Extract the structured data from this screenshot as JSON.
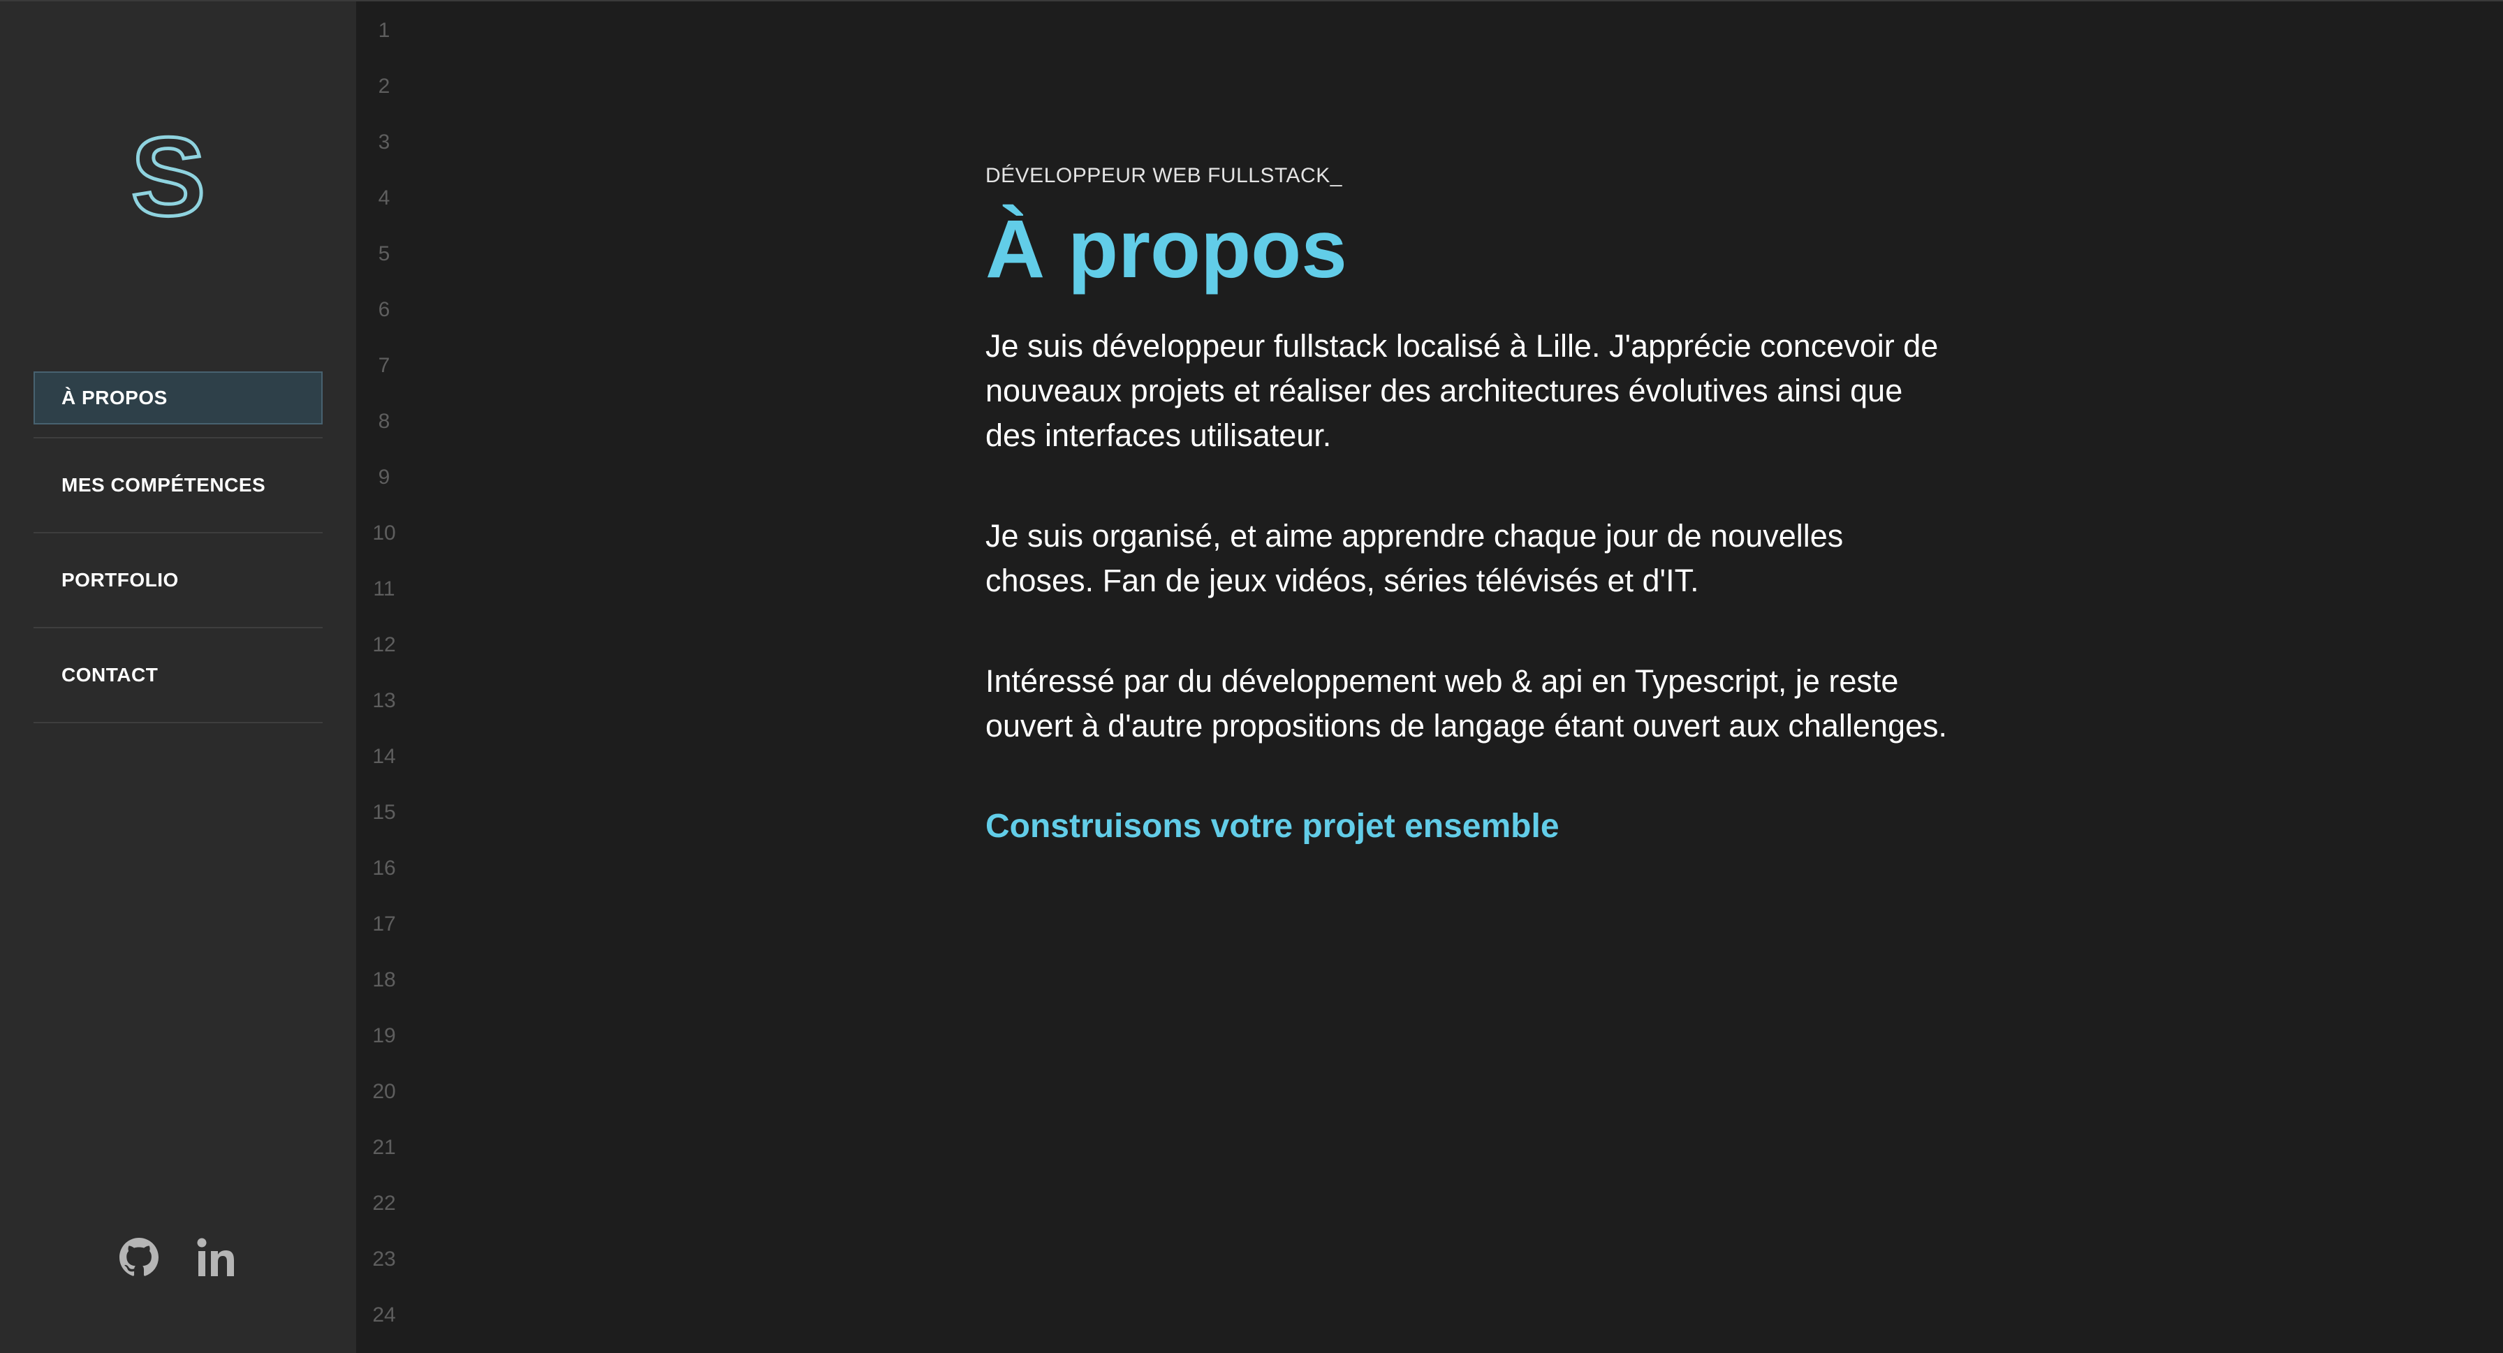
{
  "sidebar": {
    "logo_letter": "S",
    "nav": [
      {
        "label": "À PROPOS",
        "active": true
      },
      {
        "label": "MES COMPÉTENCES",
        "active": false
      },
      {
        "label": "PORTFOLIO",
        "active": false
      },
      {
        "label": "CONTACT",
        "active": false
      }
    ],
    "social_icons": [
      "github-icon",
      "linkedin-icon"
    ]
  },
  "gutter": {
    "line_numbers": [
      "1",
      "2",
      "3",
      "4",
      "5",
      "6",
      "7",
      "8",
      "9",
      "10",
      "11",
      "12",
      "13",
      "14",
      "15",
      "16",
      "17",
      "18",
      "19",
      "20",
      "21",
      "22",
      "23",
      "24"
    ]
  },
  "main": {
    "subtitle": "DÉVELOPPEUR WEB FULLSTACK_",
    "title": "À propos",
    "paragraphs": [
      "Je suis développeur fullstack localisé à Lille. J'apprécie concevoir de nouveaux projets et réaliser des architectures évolutives ainsi que des interfaces utilisateur.",
      "Je suis organisé, et aime apprendre chaque jour de nouvelles choses. Fan de jeux vidéos, séries télévisés et d'IT.",
      "Intéressé par du développement web & api en Typescript, je reste ouvert à d'autre propositions de langage étant ouvert aux challenges."
    ],
    "cta": "Construisons votre projet ensemble"
  },
  "colors": {
    "accent": "#62cde8",
    "sidebar_bg": "#2b2b2b",
    "page_bg": "#1d1d1d",
    "active_nav_bg": "#2e4049"
  }
}
